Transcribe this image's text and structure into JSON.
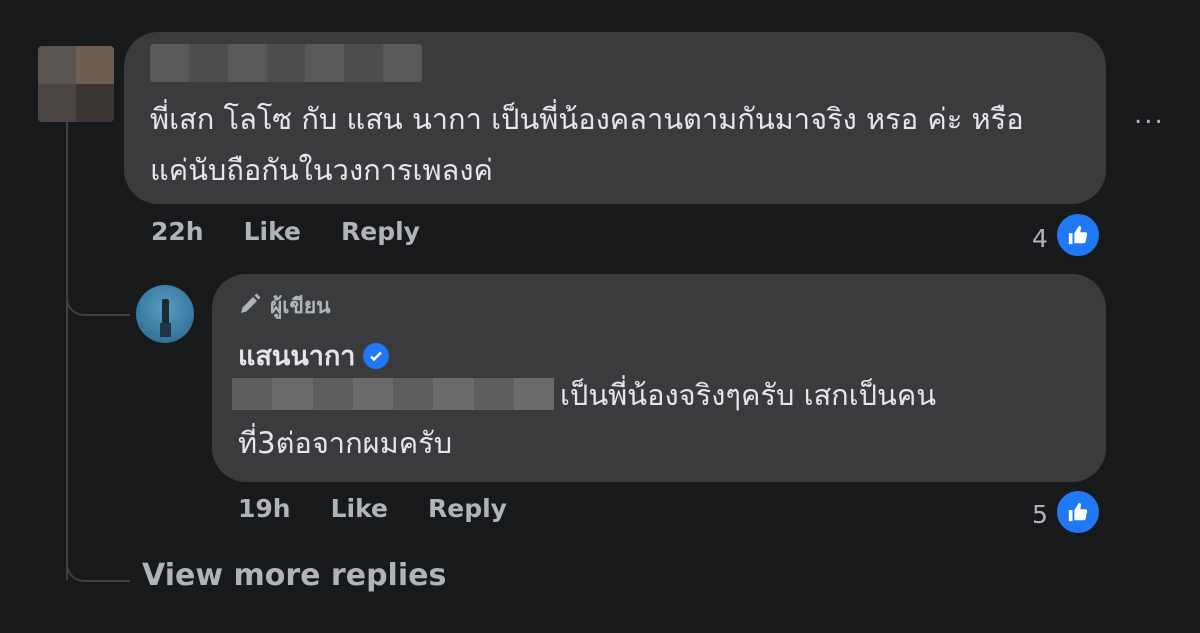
{
  "comment1": {
    "text": "พี่เสก โลโซ กับ แสน นากา เป็นพี่น้องคลานตามกันมาจริง หรอ ค่ะ หรือ แค่นับถือกันในวงการเพลงค่",
    "time": "22h",
    "like_label": "Like",
    "reply_label": "Reply",
    "reaction_count": "4",
    "more_label": "..."
  },
  "reply1": {
    "author_badge": "ผู้เขียน",
    "name": "แสนนากา",
    "text_line1": "เป็นพี่น้องจริงๆครับ เสกเป็นคน",
    "text_line2": "ที่3ต่อจากผมครับ",
    "time": "19h",
    "like_label": "Like",
    "reply_label": "Reply",
    "reaction_count": "5"
  },
  "view_more_replies": "View more replies",
  "colors": {
    "background": "#18191a",
    "bubble": "#3a3b3c",
    "like_blue": "#2078f4",
    "secondary_text": "#b0b3b8"
  },
  "icons": [
    "more-options-icon",
    "like-reaction-icon",
    "author-pen-icon",
    "verified-badge-icon"
  ]
}
